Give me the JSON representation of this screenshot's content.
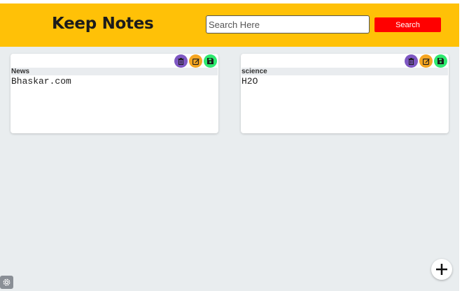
{
  "colors": {
    "header_bg": "#ffc107",
    "search_button_bg": "#ff0000",
    "delete_button_bg": "#7e57c2",
    "edit_button_bg": "#f5a623",
    "save_button_bg": "#2ee86f",
    "page_bg": "#e9edef"
  },
  "header": {
    "title": "Keep Notes",
    "search_placeholder": "Search Here",
    "search_value": "",
    "search_button": "Search"
  },
  "notes": [
    {
      "title": "News",
      "body": "Bhaskar.com"
    },
    {
      "title": "science",
      "body": "H2O"
    }
  ],
  "icons": {
    "delete": "trash-icon",
    "edit": "edit-icon",
    "save": "floppy-icon",
    "add": "plus-icon",
    "settings": "gear-icon"
  }
}
